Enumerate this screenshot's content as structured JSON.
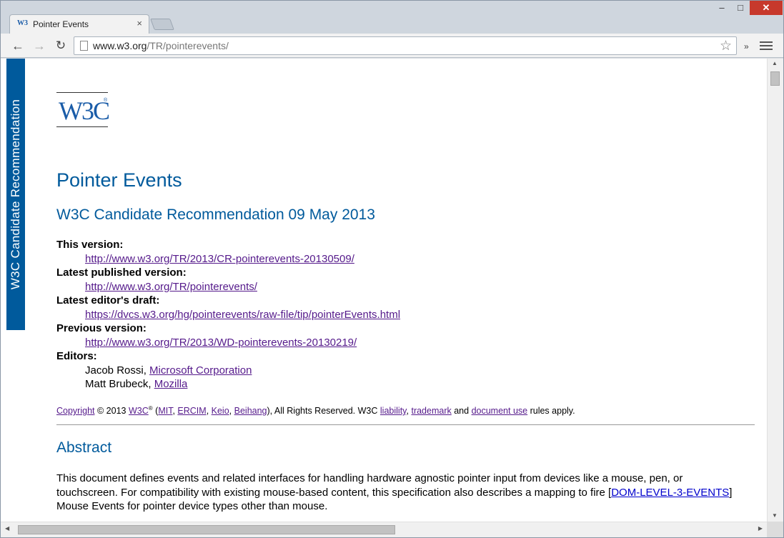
{
  "browser": {
    "tab_title": "Pointer Events",
    "tab_favicon": "W3",
    "url_host": "www.w3.org",
    "url_path": "/TR/pointerevents/",
    "extensions_chevron": "»"
  },
  "side_banner": "W3C Candidate Recommendation",
  "logo": {
    "text": "W3C",
    "reg": "®"
  },
  "document": {
    "title": "Pointer Events",
    "subtitle": "W3C Candidate Recommendation 09 May 2013",
    "meta": [
      {
        "label": "This version:",
        "link": "http://www.w3.org/TR/2013/CR-pointerevents-20130509/"
      },
      {
        "label": "Latest published version:",
        "link": "http://www.w3.org/TR/pointerevents/"
      },
      {
        "label": "Latest editor's draft:",
        "link": "https://dvcs.w3.org/hg/pointerevents/raw-file/tip/pointerEvents.html"
      },
      {
        "label": "Previous version:",
        "link": "http://www.w3.org/TR/2013/WD-pointerevents-20130219/"
      }
    ],
    "editors_label": "Editors:",
    "editors": [
      {
        "name": "Jacob Rossi,",
        "org": "Microsoft Corporation"
      },
      {
        "name": "Matt Brubeck,",
        "org": "Mozilla"
      }
    ],
    "copyright": {
      "copyright_link": "Copyright",
      "year_text": "© 2013",
      "w3c": "W3C",
      "reg": "®",
      "open": "(",
      "mit": "MIT",
      "ercim": "ERCIM",
      "keio": "Keio",
      "beihang": "Beihang",
      "reserved": "), All Rights Reserved. W3C",
      "liability": "liability",
      "comma": ",",
      "trademark": "trademark",
      "and": "and",
      "document_use": "document use",
      "tail": "rules apply."
    },
    "abstract_heading": "Abstract",
    "abstract_part1": "This document defines events and related interfaces for handling hardware agnostic pointer input from devices like a mouse, pen, or touchscreen. For compatibility with existing mouse-based content, this specification also describes a mapping to fire [",
    "abstract_ref": "DOM-LEVEL-3-EVENTS",
    "abstract_part2": "] Mouse Events for pointer device types other than mouse."
  },
  "colors": {
    "w3c_blue": "#005a9c",
    "visited_link": "#551a8b",
    "link": "#0000cc"
  }
}
